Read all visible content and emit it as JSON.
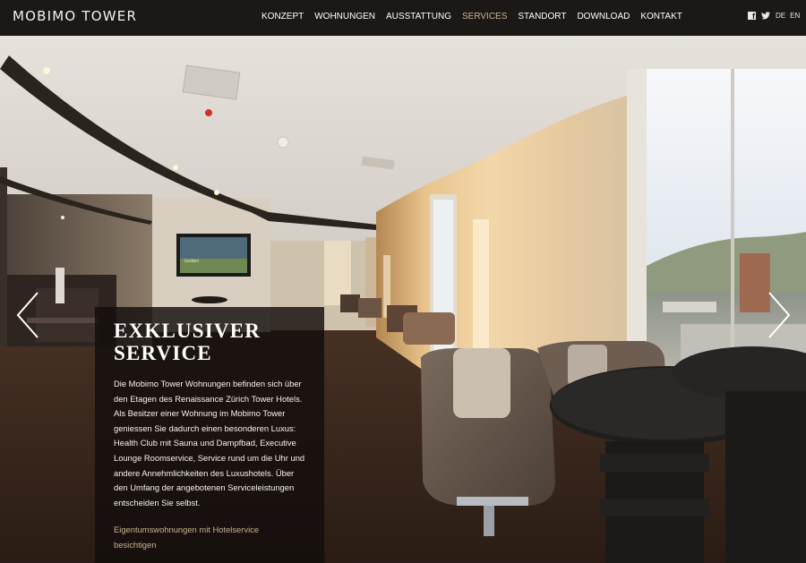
{
  "header": {
    "logo": "MOBIMO TOWER",
    "nav": [
      {
        "label": "KONZEPT",
        "active": false
      },
      {
        "label": "WOHNUNGEN",
        "active": false
      },
      {
        "label": "AUSSTATTUNG",
        "active": false
      },
      {
        "label": "SERVICES",
        "active": true
      },
      {
        "label": "STANDORT",
        "active": false
      },
      {
        "label": "DOWNLOAD",
        "active": false
      },
      {
        "label": "KONTAKT",
        "active": false
      }
    ],
    "social": {
      "facebook_icon": "facebook-icon",
      "twitter_icon": "twitter-icon"
    },
    "languages": [
      "DE",
      "EN"
    ]
  },
  "hero": {
    "image": "hotel-lounge-interior-photo",
    "prev_icon": "chevron-left-icon",
    "next_icon": "chevron-right-icon",
    "tv_text": "Golden"
  },
  "card": {
    "title_lines": [
      "EXKLUSIVER",
      "SERVICE"
    ],
    "body_lines": [
      "Die Mobimo Tower Wohnungen befinden sich über",
      "den Etagen des Renaissance Zürich Tower Hotels.",
      "Als Besitzer einer Wohnung im Mobimo Tower",
      "geniessen Sie dadurch einen besonderen Luxus:",
      "Health Club mit Sauna und Dampfbad, Executive",
      "Lounge Roomservice, Service rund um die Uhr und",
      "andere Annehmlichkeiten des Luxushotels. Über",
      "den Umfang der angebotenen Serviceleistungen",
      "entscheiden Sie selbst."
    ],
    "link_lines": [
      "Eigentumswohnungen mit Hotelservice",
      "besichtigen"
    ]
  },
  "colors": {
    "accent": "#c9b48f",
    "nav_bg": "#1c1816",
    "card_bg": "#120e0c"
  }
}
